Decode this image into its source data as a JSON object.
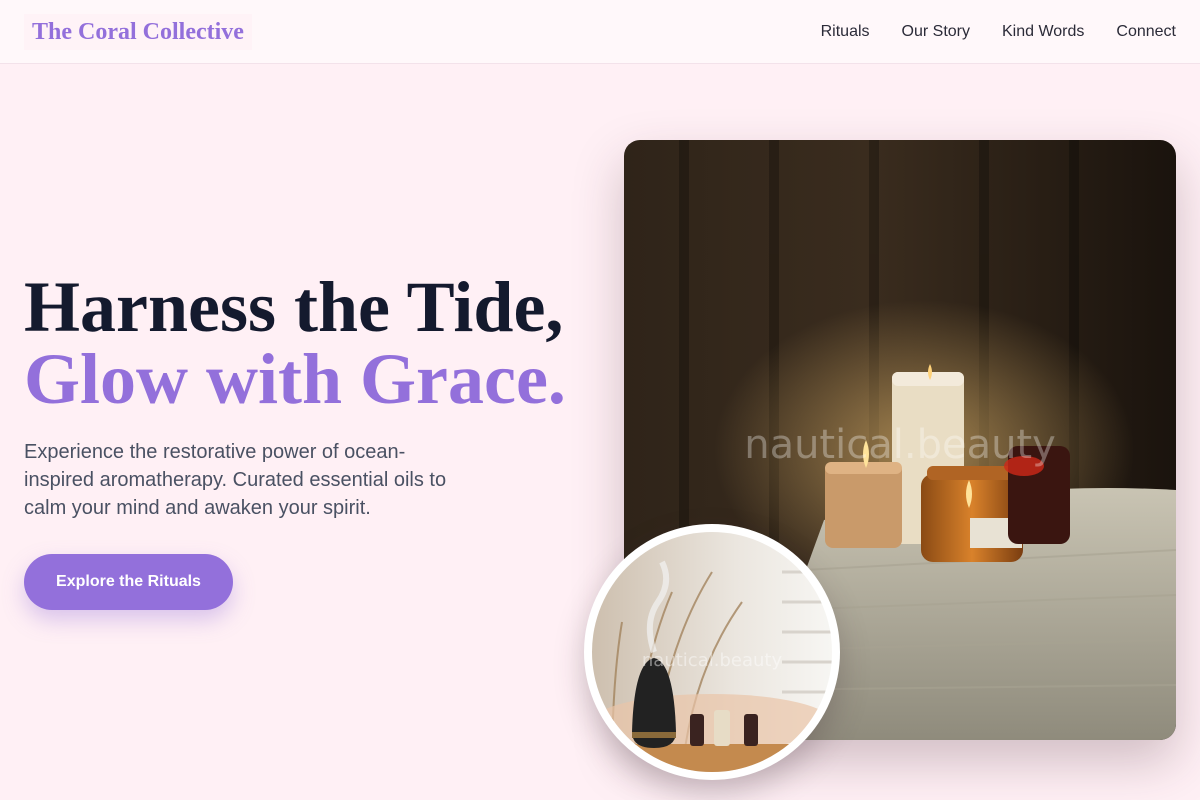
{
  "header": {
    "brand": "The Coral Collective",
    "nav": [
      "Rituals",
      "Our Story",
      "Kind Words",
      "Connect"
    ]
  },
  "hero": {
    "title_line1": "Harness the Tide,",
    "title_line2": "Glow with Grace.",
    "lead": "Experience the restorative power of ocean-inspired aromatherapy. Curated essential oils to calm your mind and awaken your spirit.",
    "cta_label": "Explore the Rituals",
    "main_image_watermark": "nautical.beauty",
    "circle_image_watermark": "nautical.beauty"
  },
  "colors": {
    "accent": "#9370db",
    "background": "#fff0f5",
    "heading": "#141a2e",
    "body_text": "#4a5163"
  }
}
